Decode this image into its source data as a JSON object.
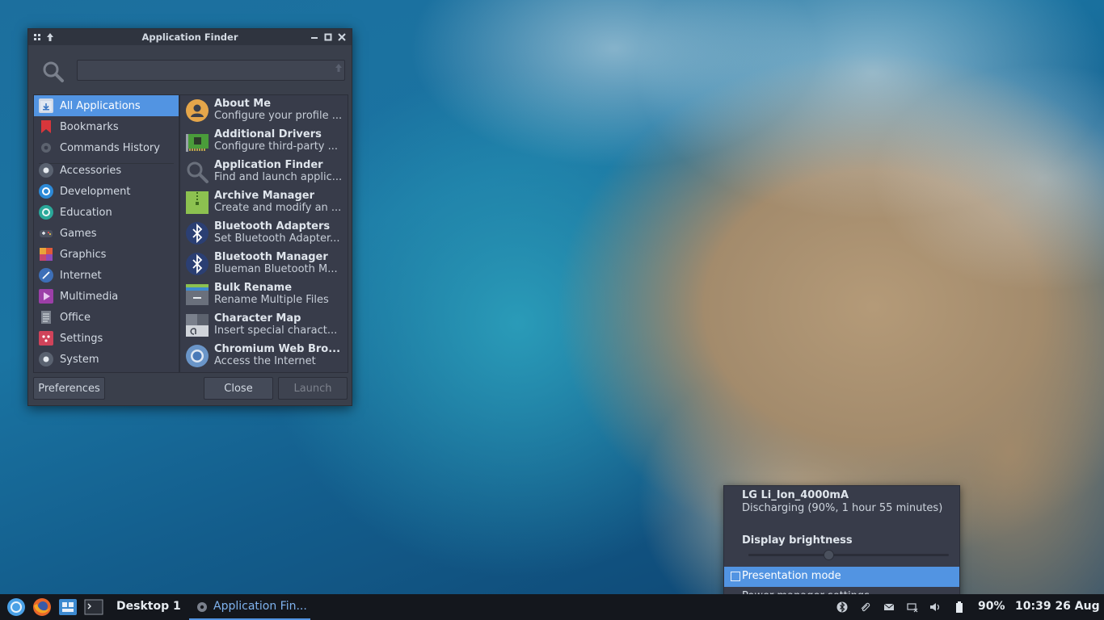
{
  "window": {
    "title": "Application Finder",
    "search_placeholder": "",
    "categories": [
      {
        "label": "All Applications",
        "icon": "all-apps-icon",
        "selected": true
      },
      {
        "label": "Bookmarks",
        "icon": "bookmark-icon"
      },
      {
        "label": "Commands History",
        "icon": "gear-icon"
      },
      {
        "label": "Accessories",
        "icon": "accessories-icon"
      },
      {
        "label": "Development",
        "icon": "development-icon"
      },
      {
        "label": "Education",
        "icon": "education-icon"
      },
      {
        "label": "Games",
        "icon": "gamepad-icon"
      },
      {
        "label": "Graphics",
        "icon": "graphics-icon"
      },
      {
        "label": "Internet",
        "icon": "internet-icon"
      },
      {
        "label": "Multimedia",
        "icon": "multimedia-icon"
      },
      {
        "label": "Office",
        "icon": "office-icon"
      },
      {
        "label": "Settings",
        "icon": "settings-icon"
      },
      {
        "label": "System",
        "icon": "system-icon"
      }
    ],
    "apps": [
      {
        "name": "About Me",
        "desc": "Configure your profile ...",
        "icon": "user-icon"
      },
      {
        "name": "Additional Drivers",
        "desc": "Configure third-party ...",
        "icon": "driver-card-icon"
      },
      {
        "name": "Application Finder",
        "desc": "Find and launch applic...",
        "icon": "search-icon"
      },
      {
        "name": "Archive Manager",
        "desc": "Create and modify an ...",
        "icon": "archive-icon"
      },
      {
        "name": "Bluetooth Adapters",
        "desc": "Set Bluetooth Adapter...",
        "icon": "bluetooth-icon"
      },
      {
        "name": "Bluetooth Manager",
        "desc": "Blueman Bluetooth M...",
        "icon": "bluetooth-icon"
      },
      {
        "name": "Bulk Rename",
        "desc": "Rename Multiple Files",
        "icon": "bulk-rename-icon"
      },
      {
        "name": "Character Map",
        "desc": "Insert special charact...",
        "icon": "character-map-icon"
      },
      {
        "name": "Chromium Web Bro...",
        "desc": "Access the Internet",
        "icon": "chromium-icon"
      }
    ],
    "buttons": {
      "preferences": "Preferences",
      "close": "Close",
      "launch": "Launch"
    }
  },
  "power_popup": {
    "device": "LG Li_Ion_4000mA",
    "status": "Discharging (90%, 1 hour 55 minutes)",
    "brightness_label": "Display brightness",
    "brightness_value": 0.4,
    "presentation_mode": "Presentation mode",
    "settings_link": "Power manager settings..."
  },
  "taskbar": {
    "workspace": "Desktop 1",
    "task_label": "Application Fin...",
    "battery_percent": "90%",
    "clock": "10:39 26 Aug"
  },
  "colors": {
    "accent": "#5294e2",
    "panel": "#383c4a",
    "taskbar": "#14171d"
  }
}
